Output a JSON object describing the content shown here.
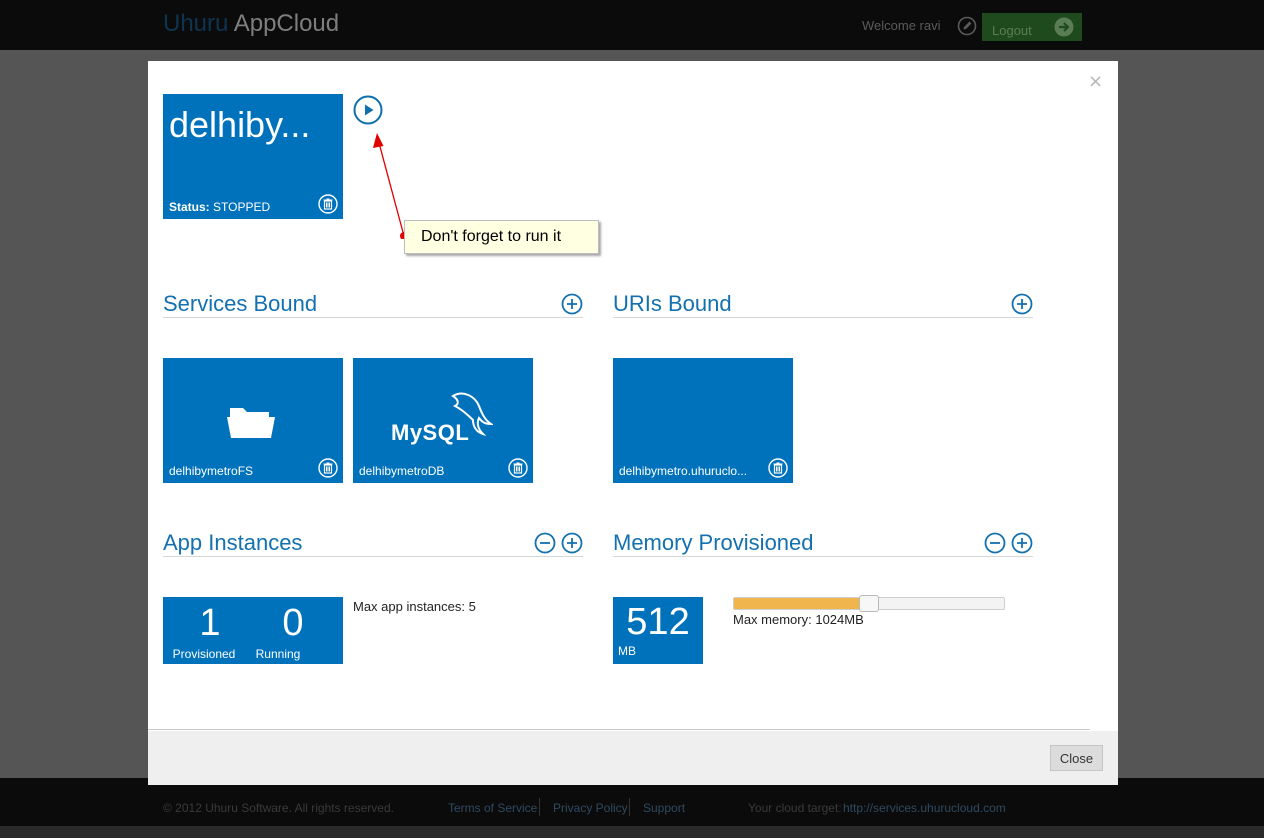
{
  "header": {
    "brand_part1": "Uhuru",
    "brand_part2": "AppCloud",
    "welcome": "Welcome ravi",
    "logout_label": "Logout"
  },
  "footer": {
    "copyright": "© 2012 Uhuru Software. All rights reserved.",
    "links": [
      "Terms of Service",
      "Privacy Policy",
      "Support"
    ],
    "target_label": "Your cloud target:",
    "target_url": "http://services.uhurucloud.com"
  },
  "modal": {
    "close_x": "×",
    "close_button": "Close",
    "app": {
      "name": "delhiby...",
      "status_label": "Status:",
      "status_value": "STOPPED"
    },
    "callout_text": "Don't forget to run it",
    "services": {
      "title": "Services Bound",
      "items": [
        {
          "label": "delhibymetroFS",
          "icon": "folder-icon"
        },
        {
          "label": "delhibymetroDB",
          "icon": "mysql-logo",
          "logo_text": "MySQL"
        }
      ]
    },
    "uris": {
      "title": "URIs Bound",
      "items": [
        {
          "label": "delhibymetro.uhuruclo..."
        }
      ]
    },
    "instances": {
      "title": "App Instances",
      "provisioned_value": "1",
      "provisioned_label": "Provisioned",
      "running_value": "0",
      "running_label": "Running",
      "max_text": "Max app instances: 5"
    },
    "memory": {
      "title": "Memory Provisioned",
      "value": "512",
      "unit": "MB",
      "max_text": "Max memory: 1024MB",
      "slider_fraction": 0.5,
      "slider_color": "#f0b54c"
    }
  },
  "colors": {
    "tile_blue": "#0072bb",
    "title_blue": "#1371b0",
    "topbar": "#0b0b0b",
    "overlay": "#555555"
  }
}
